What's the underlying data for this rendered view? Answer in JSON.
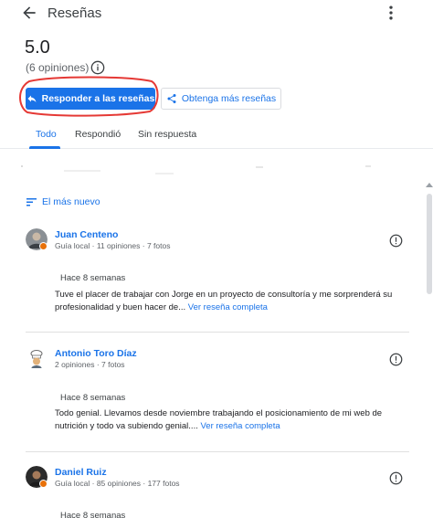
{
  "header": {
    "title": "Reseñas",
    "back_icon": "arrow-back-icon",
    "more_icon": "more-vert-icon"
  },
  "summary": {
    "rating": "5.0",
    "count": "(6 opiniones)",
    "info_icon": "info-icon"
  },
  "actions": {
    "respond_label": "Responder a las reseñas",
    "get_more_label": "Obtenga más reseñas"
  },
  "tabs": [
    {
      "label": "Todo",
      "active": true
    },
    {
      "label": "Respondió",
      "active": false
    },
    {
      "label": "Sin respuesta",
      "active": false
    }
  ],
  "sort": {
    "label": "El más nuevo"
  },
  "reviews": [
    {
      "name": "Juan Centeno",
      "meta": "Guía local · 11 opiniones · 7 fotos",
      "date": "Hace 8 semanas",
      "text": "Tuve el placer de trabajar con Jorge en un proyecto de consultoría y me sorprenderá su profesionalidad y buen hacer de...",
      "link": "Ver reseña completa"
    },
    {
      "name": "Antonio Toro Díaz",
      "meta": "2 opiniones · 7 fotos",
      "date": "Hace 8 semanas",
      "text": "Todo genial. Llevamos desde noviembre trabajando el posicionamiento de mi web de nutrición y todo va subiendo genial....",
      "link": "Ver reseña completa"
    },
    {
      "name": "Daniel Ruiz",
      "meta": "Guía local · 85 opiniones · 177 fotos",
      "date": "Hace 8 semanas"
    }
  ],
  "colors": {
    "accent": "#1a73e8",
    "annotation": "#e53935",
    "badge": "#e8710a"
  }
}
